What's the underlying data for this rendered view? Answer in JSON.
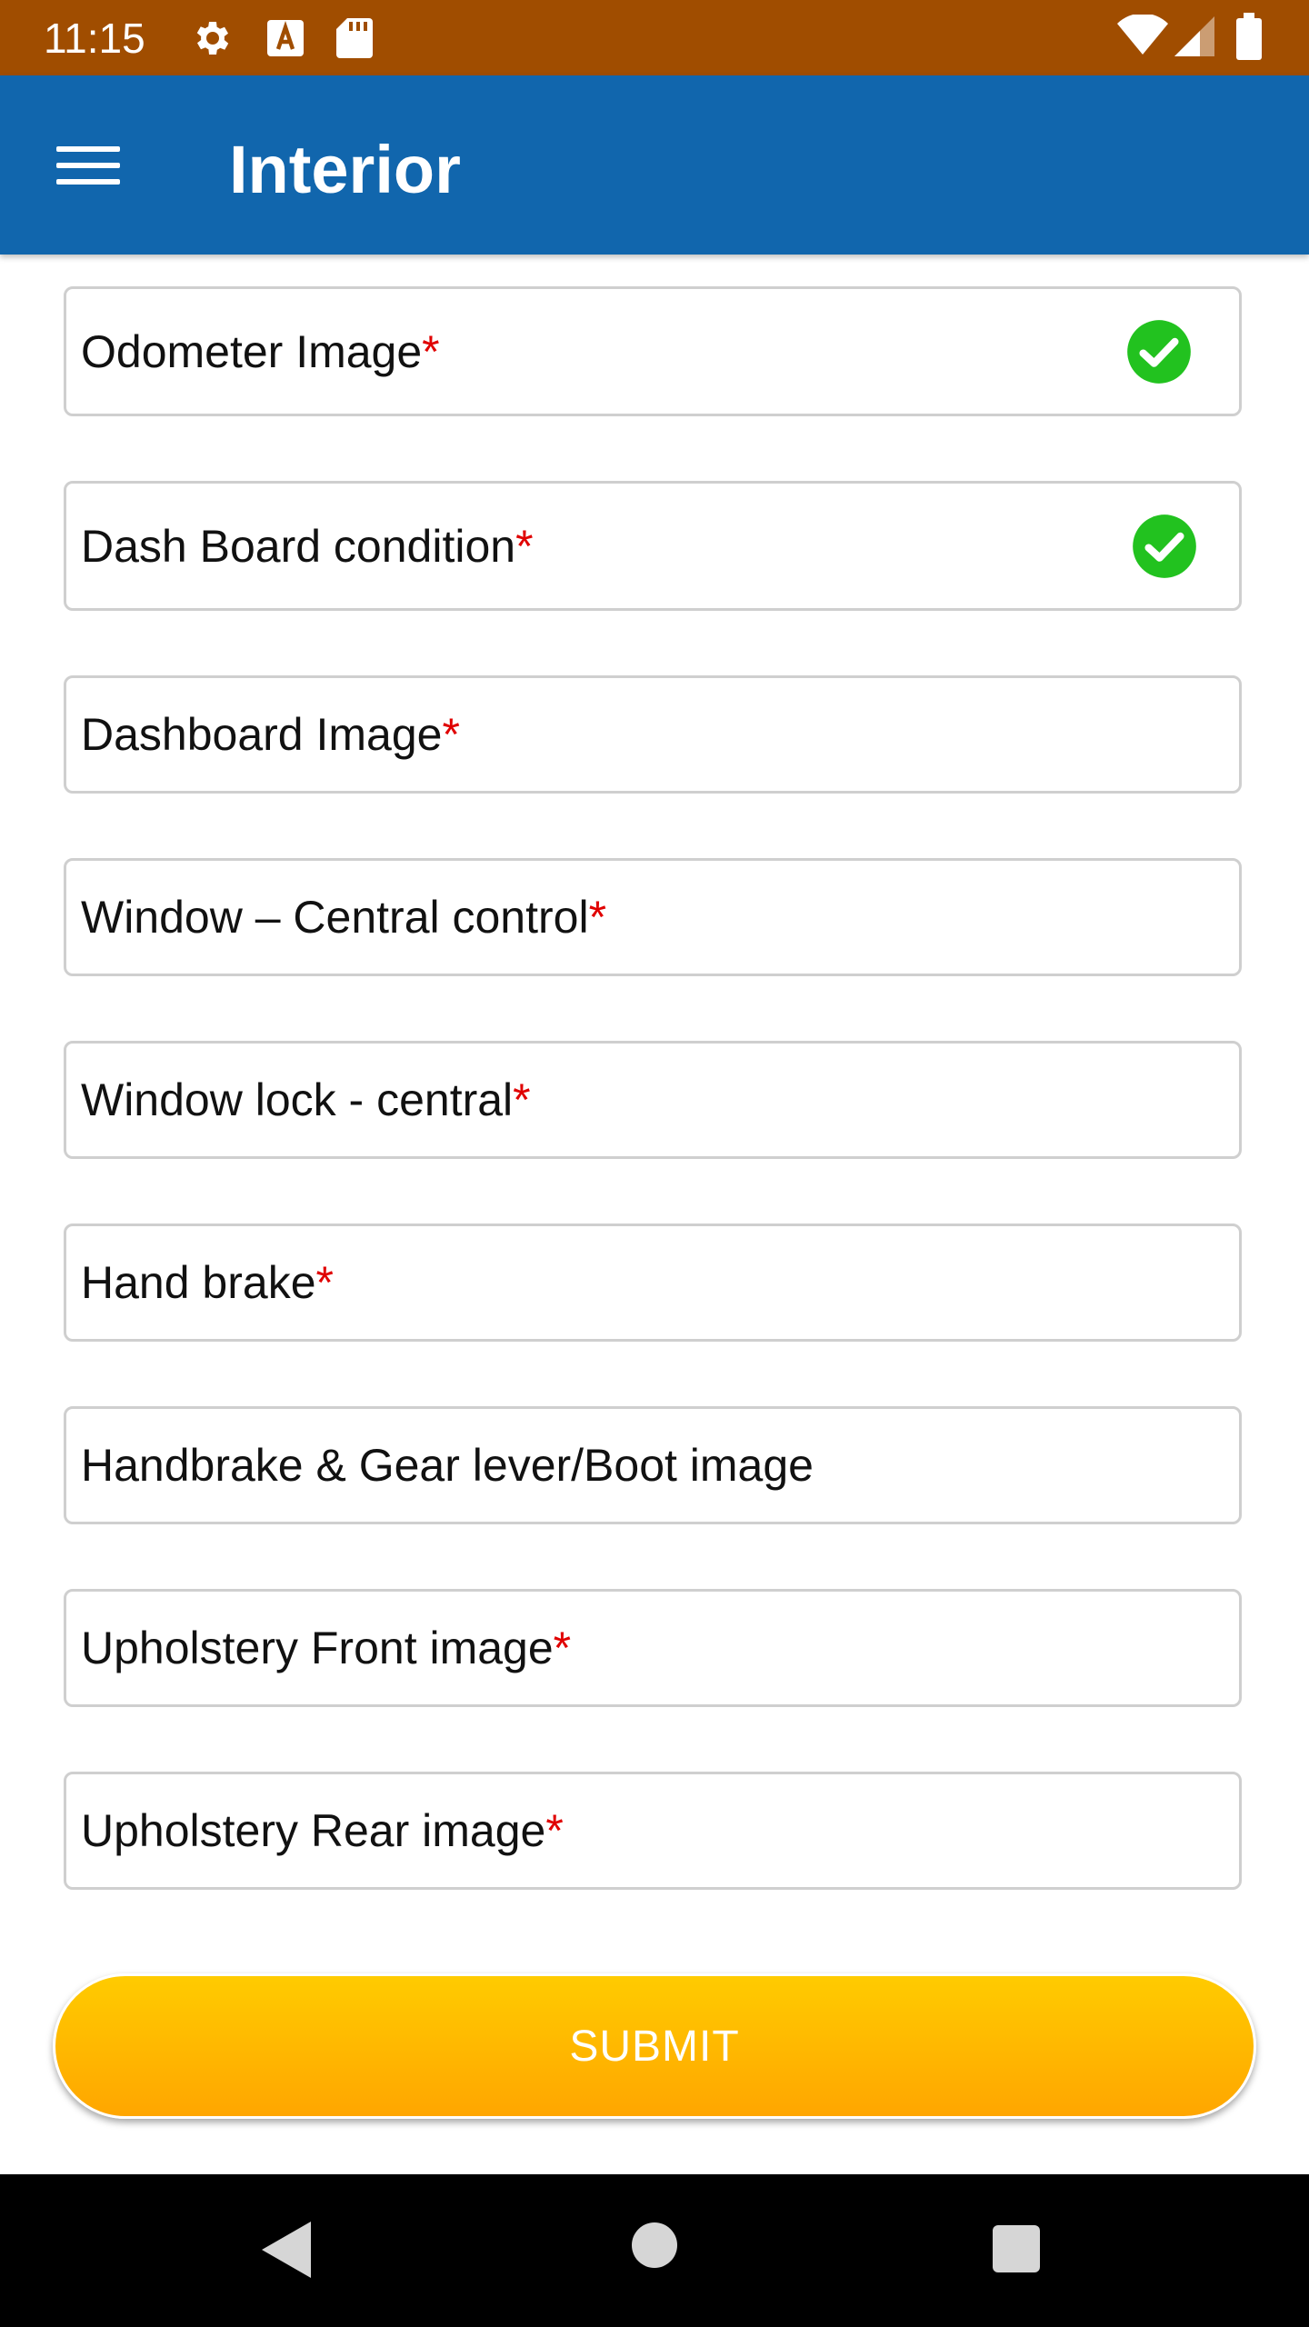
{
  "status_bar": {
    "time": "11:15",
    "icons": [
      "settings-icon",
      "font-download-icon",
      "sd-card-icon",
      "wifi-icon",
      "signal-icon",
      "battery-icon"
    ],
    "color": "#a04d00"
  },
  "app_bar": {
    "title": "Interior",
    "color": "#1166ad",
    "menu_icon": "hamburger-menu-icon"
  },
  "form": {
    "required_marker": "*",
    "fields": [
      {
        "label": "Odometer Image",
        "required": true,
        "completed": true
      },
      {
        "label": "Dash Board condition",
        "required": true,
        "completed": true
      },
      {
        "label": "Dashboard Image",
        "required": true,
        "completed": false
      },
      {
        "label": "Window – Central control",
        "required": true,
        "completed": false
      },
      {
        "label": "Window lock - central",
        "required": true,
        "completed": false
      },
      {
        "label": "Hand brake",
        "required": true,
        "completed": false
      },
      {
        "label": "Handbrake & Gear lever/Boot image",
        "required": false,
        "completed": false
      },
      {
        "label": "Upholstery Front image",
        "required": true,
        "completed": false
      },
      {
        "label": "Upholstery Rear image",
        "required": true,
        "completed": false
      }
    ],
    "submit_label": "SUBMIT",
    "accent_color": "#ffb800",
    "check_color": "#22c21f"
  },
  "nav_bar": {
    "icons": [
      "back-icon",
      "home-icon",
      "recents-icon"
    ]
  }
}
